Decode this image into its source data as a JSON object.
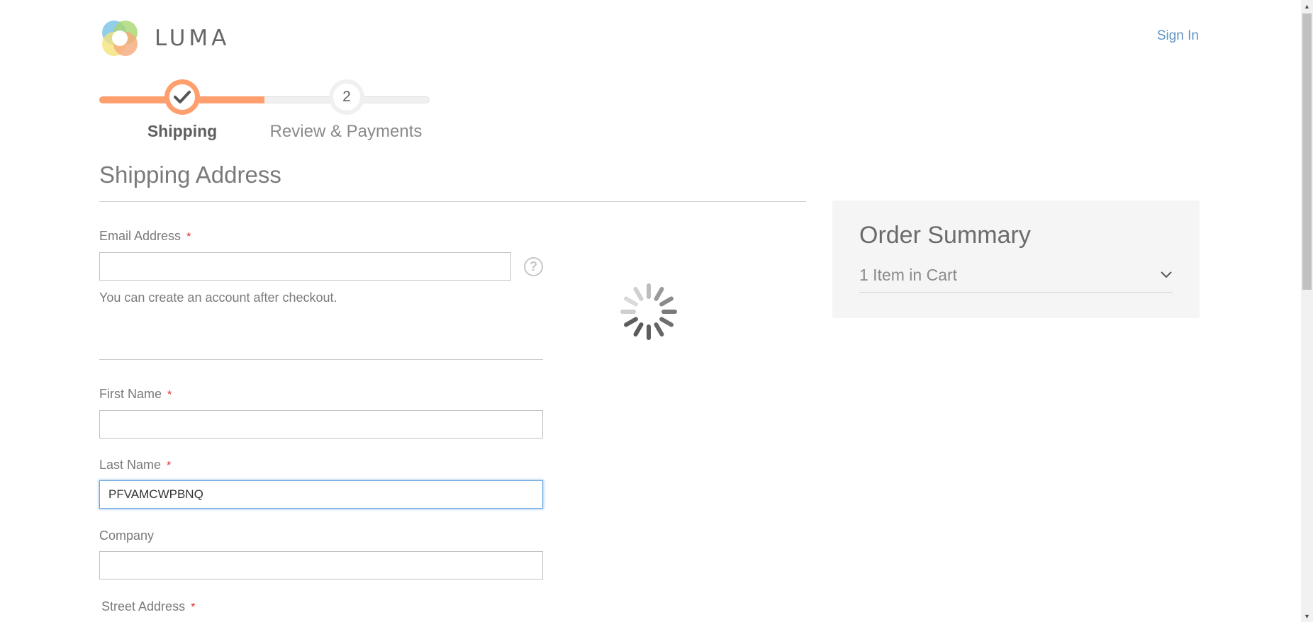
{
  "header": {
    "brand": "LUMA",
    "sign_in": "Sign In"
  },
  "progress": {
    "steps": [
      {
        "label": "Shipping",
        "status": "complete"
      },
      {
        "label": "Review & Payments",
        "number": "2",
        "status": "pending"
      }
    ],
    "completed_fraction": 0.5
  },
  "shipping": {
    "title": "Shipping Address",
    "email": {
      "label": "Email Address",
      "required": "*",
      "value": "",
      "hint": "You can create an account after checkout."
    },
    "first_name": {
      "label": "First Name",
      "required": "*",
      "value": ""
    },
    "last_name": {
      "label": "Last Name",
      "required": "*",
      "value": "PFVAMCWPBNQ"
    },
    "company": {
      "label": "Company",
      "value": ""
    },
    "street": {
      "label": "Street Address",
      "required": "*"
    }
  },
  "summary": {
    "title": "Order Summary",
    "items": "1 Item in Cart"
  },
  "colors": {
    "accent": "#ff9f6e",
    "link": "#5f94c4",
    "required": "#e02b27"
  },
  "icons": {
    "help": "question-mark-icon",
    "loader": "spinner-icon",
    "expand": "chevron-down-icon"
  }
}
